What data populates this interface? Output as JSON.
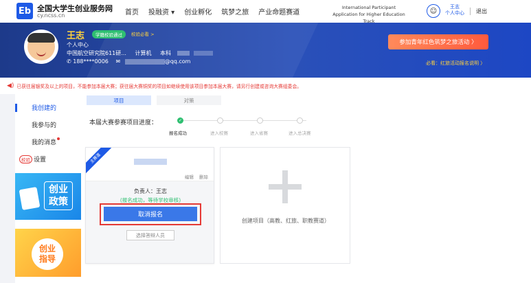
{
  "header": {
    "logo": "Eb",
    "site_title": "全国大学生创业服务网",
    "site_sub": "cy.ncss.cn",
    "nav": [
      "首页",
      "投融资 ▾",
      "创业孵化",
      "筑梦之旅",
      "产业命题赛道"
    ],
    "nav_en": "International Participant Application for Higher Education Track",
    "user_small": "王志\n个人中心",
    "logout": "退出"
  },
  "banner": {
    "name": "王志",
    "badge1": "学籍校验通过",
    "badge2": "校验必看 >",
    "center": "个人中心",
    "school": "中国航空研究院611研...",
    "major": "计算机",
    "degree": "本科",
    "phone": "188****0006",
    "email_suffix": "@qq.com",
    "red_button": "参加青年红色筑梦之旅活动  〉",
    "must_read": "必看：红旅活动报名说明 〉"
  },
  "notice": {
    "text": "已获往届银奖及以上的项目，不能参加本届大赛；获往届大赛铜奖的项目如继续使用该项目参加本届大赛，请另行创建或咨询大赛组委会。"
  },
  "sidebar": {
    "items": [
      {
        "label": "我创建的",
        "active": true
      },
      {
        "label": "我参与的",
        "active": false
      },
      {
        "label": "我的消息",
        "active": false
      },
      {
        "label": "设置",
        "active": false
      }
    ],
    "settings_pill": "校验",
    "promo1_text": "创业\n政策",
    "promo2_text": "创业\n指导"
  },
  "main": {
    "tabs": [
      "项目",
      "对策"
    ],
    "progress_label": "本届大赛参赛项目进度：",
    "steps": [
      {
        "label": "报名成功",
        "done": true
      },
      {
        "label": "进入校赛",
        "done": false
      },
      {
        "label": "进入省赛",
        "done": false
      },
      {
        "label": "进入总决赛",
        "done": false
      }
    ],
    "card": {
      "ribbon": "主赛道",
      "edit": "编辑",
      "delete": "删除",
      "owner": "负责人：王志",
      "status": "(报名成功，等待学校审核)",
      "cancel": "取消报名",
      "pick": "选择答辩人员"
    },
    "create_label": "创建项目（高教、红旅、职教赛道）"
  }
}
